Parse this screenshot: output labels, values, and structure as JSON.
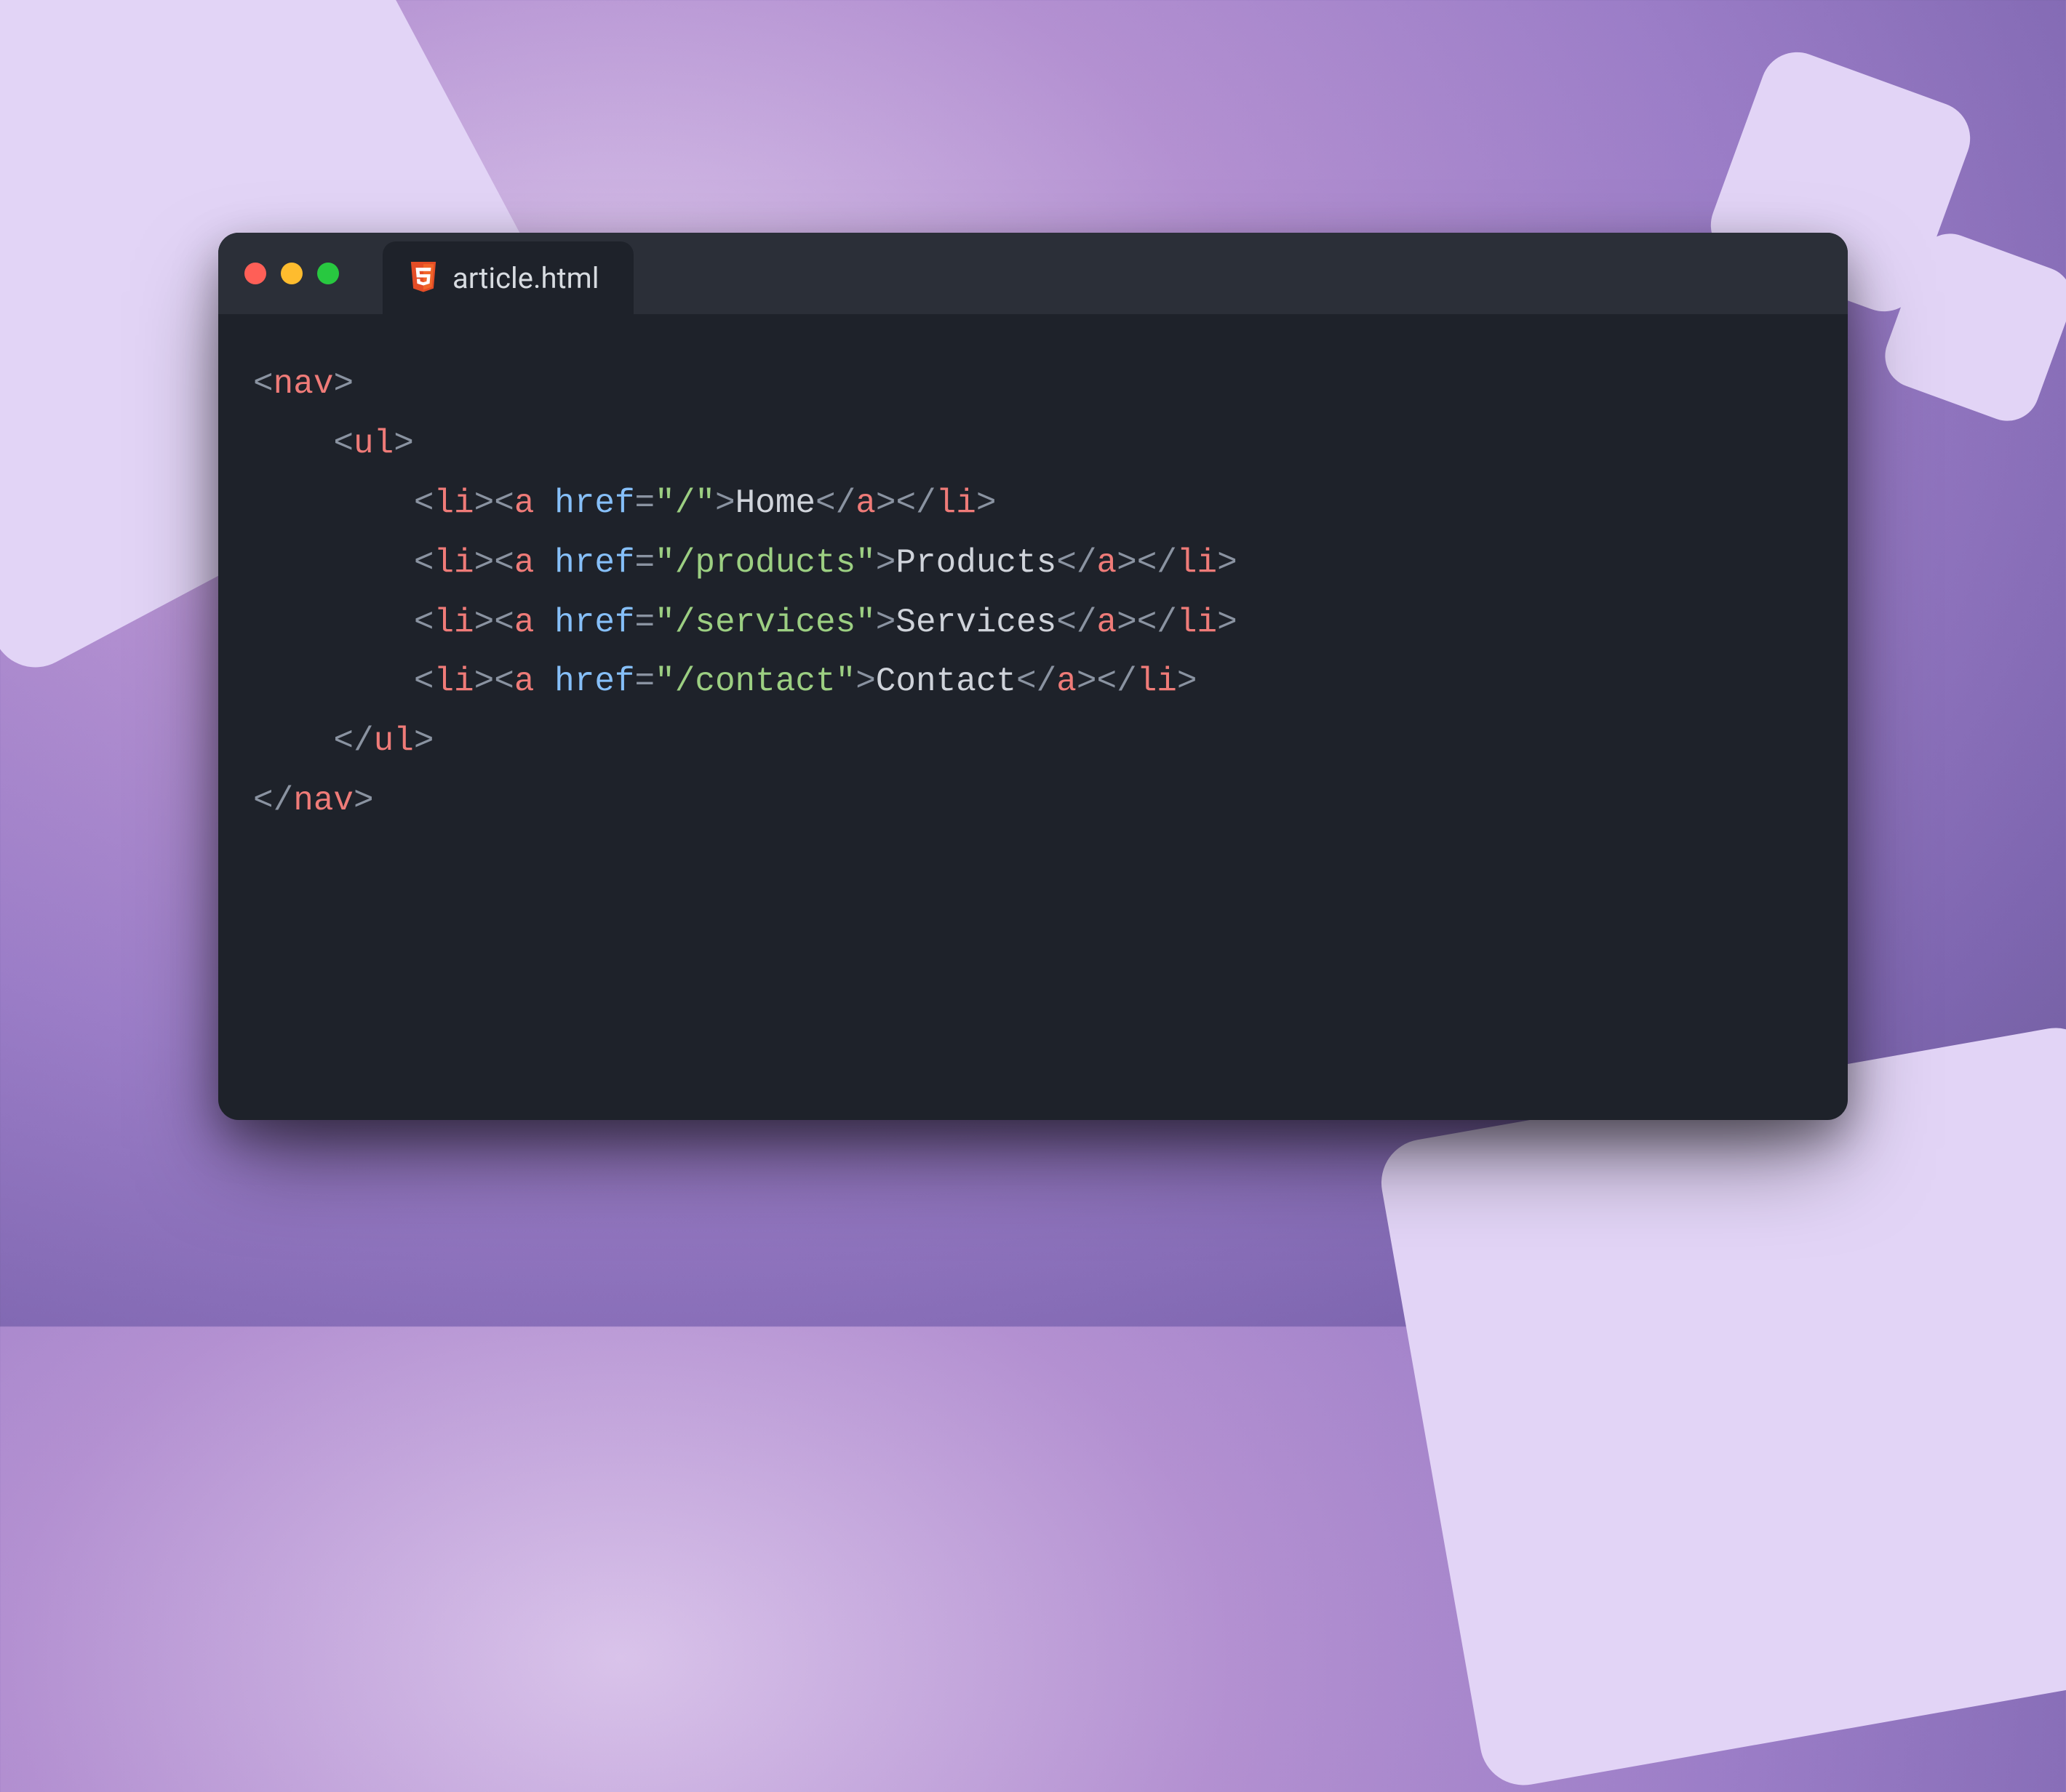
{
  "window": {
    "file_name": "article.html",
    "file_icon": "html5-icon"
  },
  "colors": {
    "editor_bg": "#1e222a",
    "titlebar_bg": "#2b2f38",
    "traffic_red": "#ff5f57",
    "traffic_yellow": "#febc2e",
    "traffic_green": "#28c840",
    "syntax_tag": "#ef7b78",
    "syntax_attr": "#86bff8",
    "syntax_string": "#9ccf82",
    "syntax_bracket": "#8a93a1",
    "syntax_text": "#cfd3da",
    "bg_accent": "#e2d4f6"
  },
  "code": {
    "lines": [
      {
        "indent": 0,
        "open": "nav"
      },
      {
        "indent": 1,
        "open": "ul"
      },
      {
        "indent": 2,
        "li_link": {
          "href": "/",
          "text": "Home"
        }
      },
      {
        "indent": 2,
        "li_link": {
          "href": "/products",
          "text": "Products"
        }
      },
      {
        "indent": 2,
        "li_link": {
          "href": "/services",
          "text": "Services"
        }
      },
      {
        "indent": 2,
        "li_link": {
          "href": "/contact",
          "text": "Contact"
        }
      },
      {
        "indent": 1,
        "close": "ul"
      },
      {
        "indent": 0,
        "close": "nav"
      }
    ]
  }
}
